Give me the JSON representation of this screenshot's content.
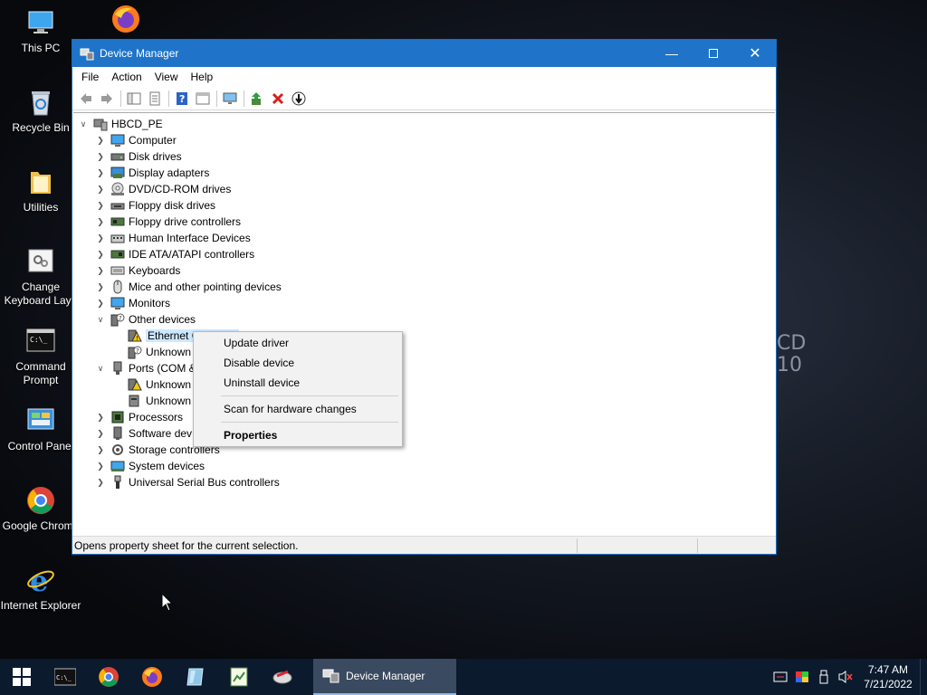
{
  "wallpaper": {
    "line1": "CD",
    "line2": "10"
  },
  "desktop_icons": [
    {
      "label": "This PC"
    },
    {
      "label": ""
    },
    {
      "label": "Recycle Bin"
    },
    {
      "label": "Utilities"
    },
    {
      "label": "Change Keyboard Layo"
    },
    {
      "label": "Command Prompt"
    },
    {
      "label": "Control Panel"
    },
    {
      "label": "Google Chrome"
    },
    {
      "label": "Internet Explorer"
    }
  ],
  "window": {
    "title": "Device Manager",
    "menu": [
      "File",
      "Action",
      "View",
      "Help"
    ],
    "tree": {
      "root": "HBCD_PE",
      "items": [
        "Computer",
        "Disk drives",
        "Display adapters",
        "DVD/CD-ROM drives",
        "Floppy disk drives",
        "Floppy drive controllers",
        "Human Interface Devices",
        "IDE ATA/ATAPI controllers",
        "Keyboards",
        "Mice and other pointing devices",
        "Monitors",
        "Other devices",
        "Ethernet C",
        "Unknown",
        "Ports (COM &",
        "Unknown",
        "Unknown",
        "Processors",
        "Software dev",
        "Storage controllers",
        "System devices",
        "Universal Serial Bus controllers"
      ]
    },
    "status": "Opens property sheet for the current selection."
  },
  "context_menu": {
    "items": [
      "Update driver",
      "Disable device",
      "Uninstall device",
      "Scan for hardware changes",
      "Properties"
    ]
  },
  "taskbar": {
    "active_task": "Device Manager",
    "time": "7:47 AM",
    "date": "7/21/2022"
  },
  "colors": {
    "titlebar": "#1f74c9",
    "selection": "#cce8ff",
    "taskbar": "#0b1a2c"
  }
}
